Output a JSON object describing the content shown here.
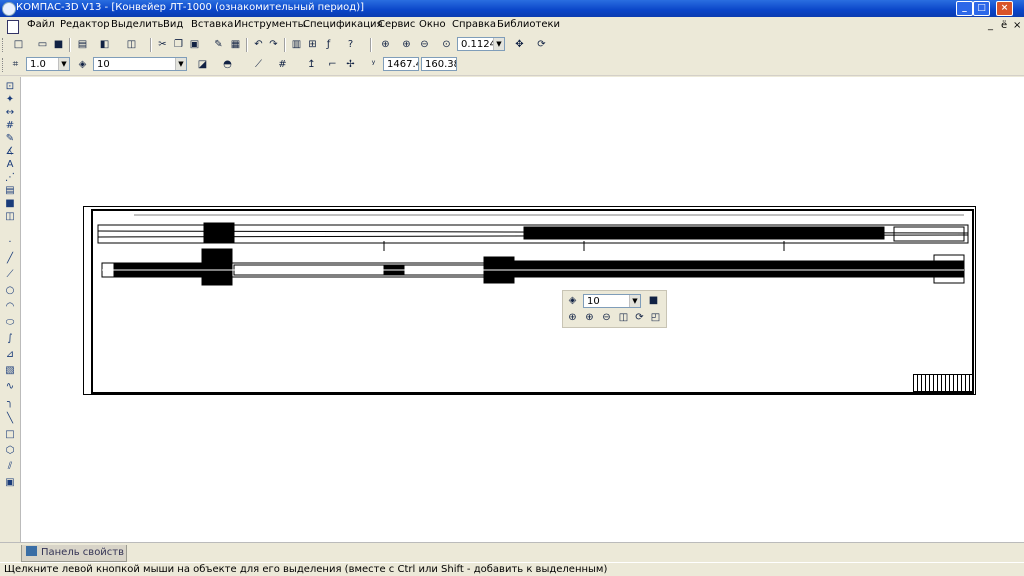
{
  "window": {
    "title": "КОМПАС-3D V13 - [Конвейер ЛТ-1000 (ознакомительный период)]",
    "minimize": "_",
    "restore": "□",
    "close": "×"
  },
  "menu": {
    "items": [
      "Файл",
      "Редактор",
      "Выделить",
      "Вид",
      "Вставка",
      "Инструменты",
      "Спецификация",
      "Сервис",
      "Окно",
      "Справка",
      "Библиотеки"
    ],
    "mdi_min": "_",
    "mdi_restore": "ё",
    "mdi_close": "×"
  },
  "toolbar1": {
    "zoom_value": "0.1124"
  },
  "toolbar2": {
    "scale_value": "1.0",
    "layer_value": "10",
    "coord_x": "1467.4",
    "coord_y": "160.38"
  },
  "float_panel": {
    "layer_value": "10"
  },
  "bottom": {
    "panel_tab": "Панель свойств"
  },
  "status": {
    "hint": "Щелкните левой кнопкой мыши на объекте для его выделения (вместе с Ctrl или Shift - добавить к выделенным)"
  }
}
